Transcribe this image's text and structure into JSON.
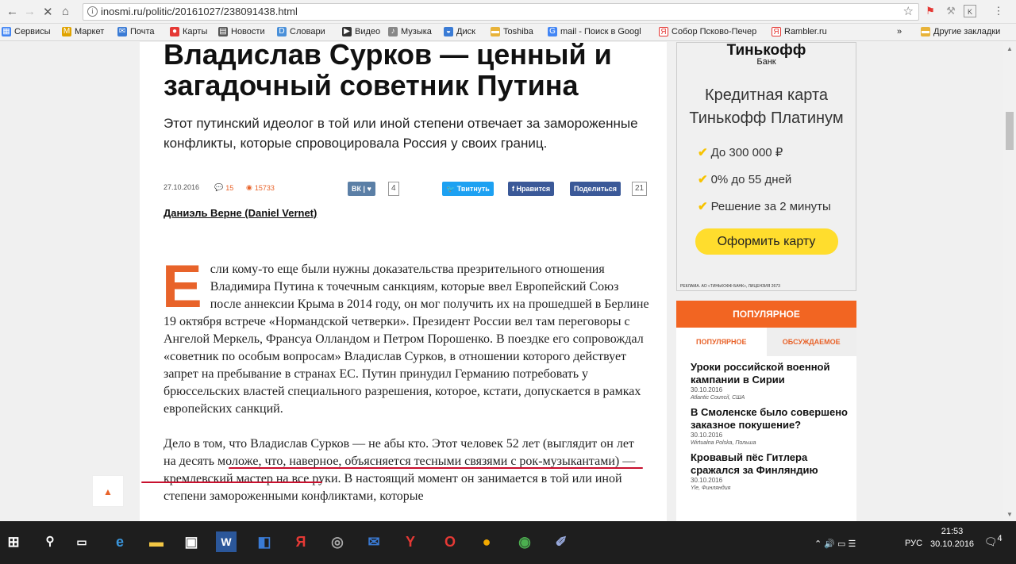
{
  "browser": {
    "url": "inosmi.ru/politic/20161027/238091438.html",
    "bookmarks": [
      "Сервисы",
      "Маркет",
      "Почта",
      "Карты",
      "Новости",
      "Словари",
      "Видео",
      "Музыка",
      "Диск",
      "Toshiba",
      "mail - Поиск в Googl",
      "Собор Псково-Печер",
      "Rambler.ru"
    ],
    "other_bookmarks": "Другие закладки",
    "overflow": "»"
  },
  "article": {
    "title": "Владислав Сурков — ценный и загадочный советник Путина",
    "lead": "Этот путинский идеолог в той или иной степени отвечает за замороженные конфликты, которые спровоцировала Россия у своих границ.",
    "date": "27.10.2016",
    "comments": "15",
    "views": "15733",
    "vk_count": "4",
    "tweet_label": "Твитнуть",
    "fb_like_label": "Нравится",
    "share_label": "Поделиться",
    "share_count": "21",
    "author": "Даниэль Верне (Daniel Vernet)",
    "dropcap": "Е",
    "p1": "сли кому-то еще были нужны доказательства презрительного отношения Владимира Путина к точечным санкциям, которые ввел Европейский Союз после аннексии Крыма в 2014 году, он мог получить их на прошедшей в Берлине 19 октября встрече «Нормандской четверки». Президент России вел там переговоры с Ангелой Меркель, Франсуа Олландом и Петром Порошенко. В поездке его сопровождал «советник по особым вопросам» Владислав Сурков, в отношении которого действует запрет на пребывание в странах ЕС. Путин принудил Германию потребовать у брюссельских властей специального разрешения, которое, кстати, допускается в рамках европейских санкций.",
    "p2": "Дело в том, что Владислав Сурков — не абы кто. Этот человек 52 лет (выглядит он лет на десять моложе, что, наверное, объясняется тесными связями с рок-музыкантами) — кремлевский мастер на все руки. В настоящий момент он занимается в той или иной степени замороженными конфликтами, которые"
  },
  "ad": {
    "bank": "Тинькофф",
    "bank_sub": "Банк",
    "card": "Кредитная карта Тинькофф Платинум",
    "features": [
      "До 300 000 ₽",
      "0% до 55 дней",
      "Решение за 2 минуты"
    ],
    "button": "Оформить карту",
    "legal": "РЕКЛАМА. АО «ТИНЬКОФФ БАНК», ЛИЦЕНЗИЯ 2673"
  },
  "popular": {
    "header": "ПОПУЛЯРНОЕ",
    "tabs": [
      "ПОПУЛЯРНОЕ",
      "ОБСУЖДАЕМОЕ"
    ],
    "items": [
      {
        "title": "Уроки российской военной кампании в Сирии",
        "date": "30.10.2016",
        "source": "Atlantic Council, США"
      },
      {
        "title": "В Смоленске было совершено заказное покушение?",
        "date": "30.10.2016",
        "source": "Wirtualna Polska, Польша"
      },
      {
        "title": "Кровавый пёс Гитлера сражался за Финляндию",
        "date": "30.10.2016",
        "source": "Yle, Финляндия"
      }
    ]
  },
  "taskbar": {
    "lang": "РУС",
    "time": "21:53",
    "date": "30.10.2016",
    "notifications": "4"
  },
  "colors": {
    "accent": "#f26522",
    "underline": "#c8102e",
    "vk": "#5b7fa6",
    "twitter": "#1da1f2",
    "facebook": "#3b5998"
  }
}
